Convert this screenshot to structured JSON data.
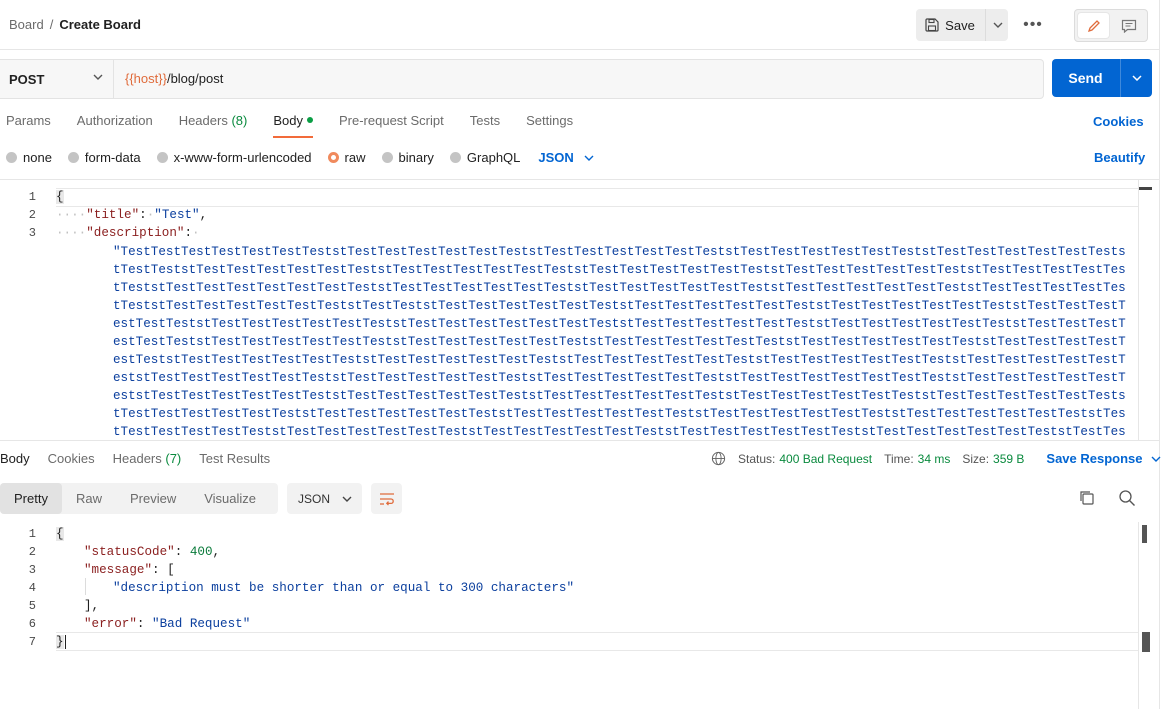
{
  "breadcrumb": {
    "parent": "Board",
    "separator": "/",
    "current": "Create Board"
  },
  "toolbar": {
    "save_label": "Save",
    "more_label": "•••"
  },
  "request": {
    "method": "POST",
    "url_variable": "{{host}}",
    "url_path": "/blog/post",
    "send_label": "Send"
  },
  "req_tabs": [
    {
      "label": "Params"
    },
    {
      "label": "Authorization"
    },
    {
      "label": "Headers",
      "count": "(8)"
    },
    {
      "label": "Body",
      "active": true
    },
    {
      "label": "Pre-request Script"
    },
    {
      "label": "Tests"
    },
    {
      "label": "Settings"
    }
  ],
  "cookies_label": "Cookies",
  "body_types": [
    "none",
    "form-data",
    "x-www-form-urlencoded",
    "raw",
    "binary",
    "GraphQL"
  ],
  "body_type_selected": "raw",
  "body_format": "JSON",
  "beautify_label": "Beautify",
  "request_body": {
    "line_numbers": [
      "1",
      "2",
      "3"
    ],
    "open_brace": "{",
    "title_key": "\"title\"",
    "title_value": "\"Test\"",
    "description_key": "\"description\"",
    "description_value": "\"TestTestTestTestTestTestTeststTestTestTestTestTestTeststTestTestTestTestTestTeststTestTestTestTestTestTeststTestTestTestTestTestTeststTestTeststTestTestTestTestTestTeststTestTestTestTestTestTeststTestTestTestTestTestTeststTestTestTestTestTestTeststTestTestTestTestTestTeststTestTestTestTestTestTestTeststTestTestTestTestTestTeststTestTestTestTestTestTeststTestTestTestTestTestTeststTestTestTestTestTestTeststTestTestTestTestTestTeststTestTeststTestTestTestTestTestTeststTestTestTestTestTestTeststTestTestTestTestTestTeststTestTestTestTestTestTeststTestTestTestTestTestTeststTestTestTestTestTestTestTeststTestTestTestTestTestTeststTestTestTestTestTestTeststTestTestTestTestTestTeststTestTestTestTestTestTeststTestTestTestTestTestTeststTestTestTestTestTestTeststTestTestTestTestTestTeststTestTestTestTestTestTeststTestTestTestTestTestTeststTestTestTestTestTestTeststTestTestTestTestTestTeststTestTestTestTestTestTeststTestTestTestTestTestTeststTestTestTestTestTestTeststTestTestTestTestTestTeststTestTestTestTestTestTeststTestTestTestTestTestTestTeststTestTestTestTestTestTeststTestTestTestTestTestTeststTestTestTestTestTestTeststTestTestTestTestTestTeststTestTestTestTestTestTeststTestTestTestTestTestTeststTestTestTestTestTestTeststTestTestTestTestTestTeststTestTestTestTestTestTeststTestTestTestTestTestTeststTestTestTestTestTestTeststTestTestTestTestTestTeststTestTestTestTestTestTeststTestTestTestTestTestTeststTestTestTestTestTestTeststTestTestTestTestTestTeststTestTestTestTestTestTeststTestTestTestTestTestTeststTestTestTestTestTestTeststTestTestTestTestTestTeststTestTestTestTestTestTeststTestTestTestTestTestTeststTestTestTestTestTestTeststTestTestTestTestTestTeststTestTestTestTestTestTeststTestTestTestTestTestTeststTestTestTestTestTestTeststTestTestTestTestTestTeststTestTestTestTestTestTeststTestTestTestTestTestTeststTestTestTestTestTestTeststTestTestTestTestTestTeststTestTestTestTestTestTeststTestTestTestTestTestTeststTestTestTestTestTestTeststTestTestTestTestTestTeststTestTestTestTestTestTeststTestTestTestTestTestTeststTestTestTestTestTestTest"
  },
  "response": {
    "tabs": [
      {
        "label": "Body",
        "active": true
      },
      {
        "label": "Cookies"
      },
      {
        "label": "Headers",
        "count": "(7)"
      },
      {
        "label": "Test Results"
      }
    ],
    "status_label": "Status:",
    "status_value": "400 Bad Request",
    "time_label": "Time:",
    "time_value": "34 ms",
    "size_label": "Size:",
    "size_value": "359 B",
    "save_response_label": "Save Response",
    "view_tabs": [
      "Pretty",
      "Raw",
      "Preview",
      "Visualize"
    ],
    "view_active": "Pretty",
    "format": "JSON",
    "line_numbers": [
      "1",
      "2",
      "3",
      "4",
      "5",
      "6",
      "7"
    ],
    "body": {
      "open_brace": "{",
      "status_code_key": "\"statusCode\"",
      "status_code_value": "400",
      "message_key": "\"message\"",
      "message_open": "[",
      "message_item": "\"description must be shorter than or equal to 300 characters\"",
      "message_close": "],",
      "error_key": "\"error\"",
      "error_value": "\"Bad Request\"",
      "close_brace": "}"
    }
  },
  "colors": {
    "accent": "#0265d2",
    "tab_underline": "#f26b3a",
    "status_ok": "#0a8a3e",
    "variable": "#e06c3c"
  }
}
